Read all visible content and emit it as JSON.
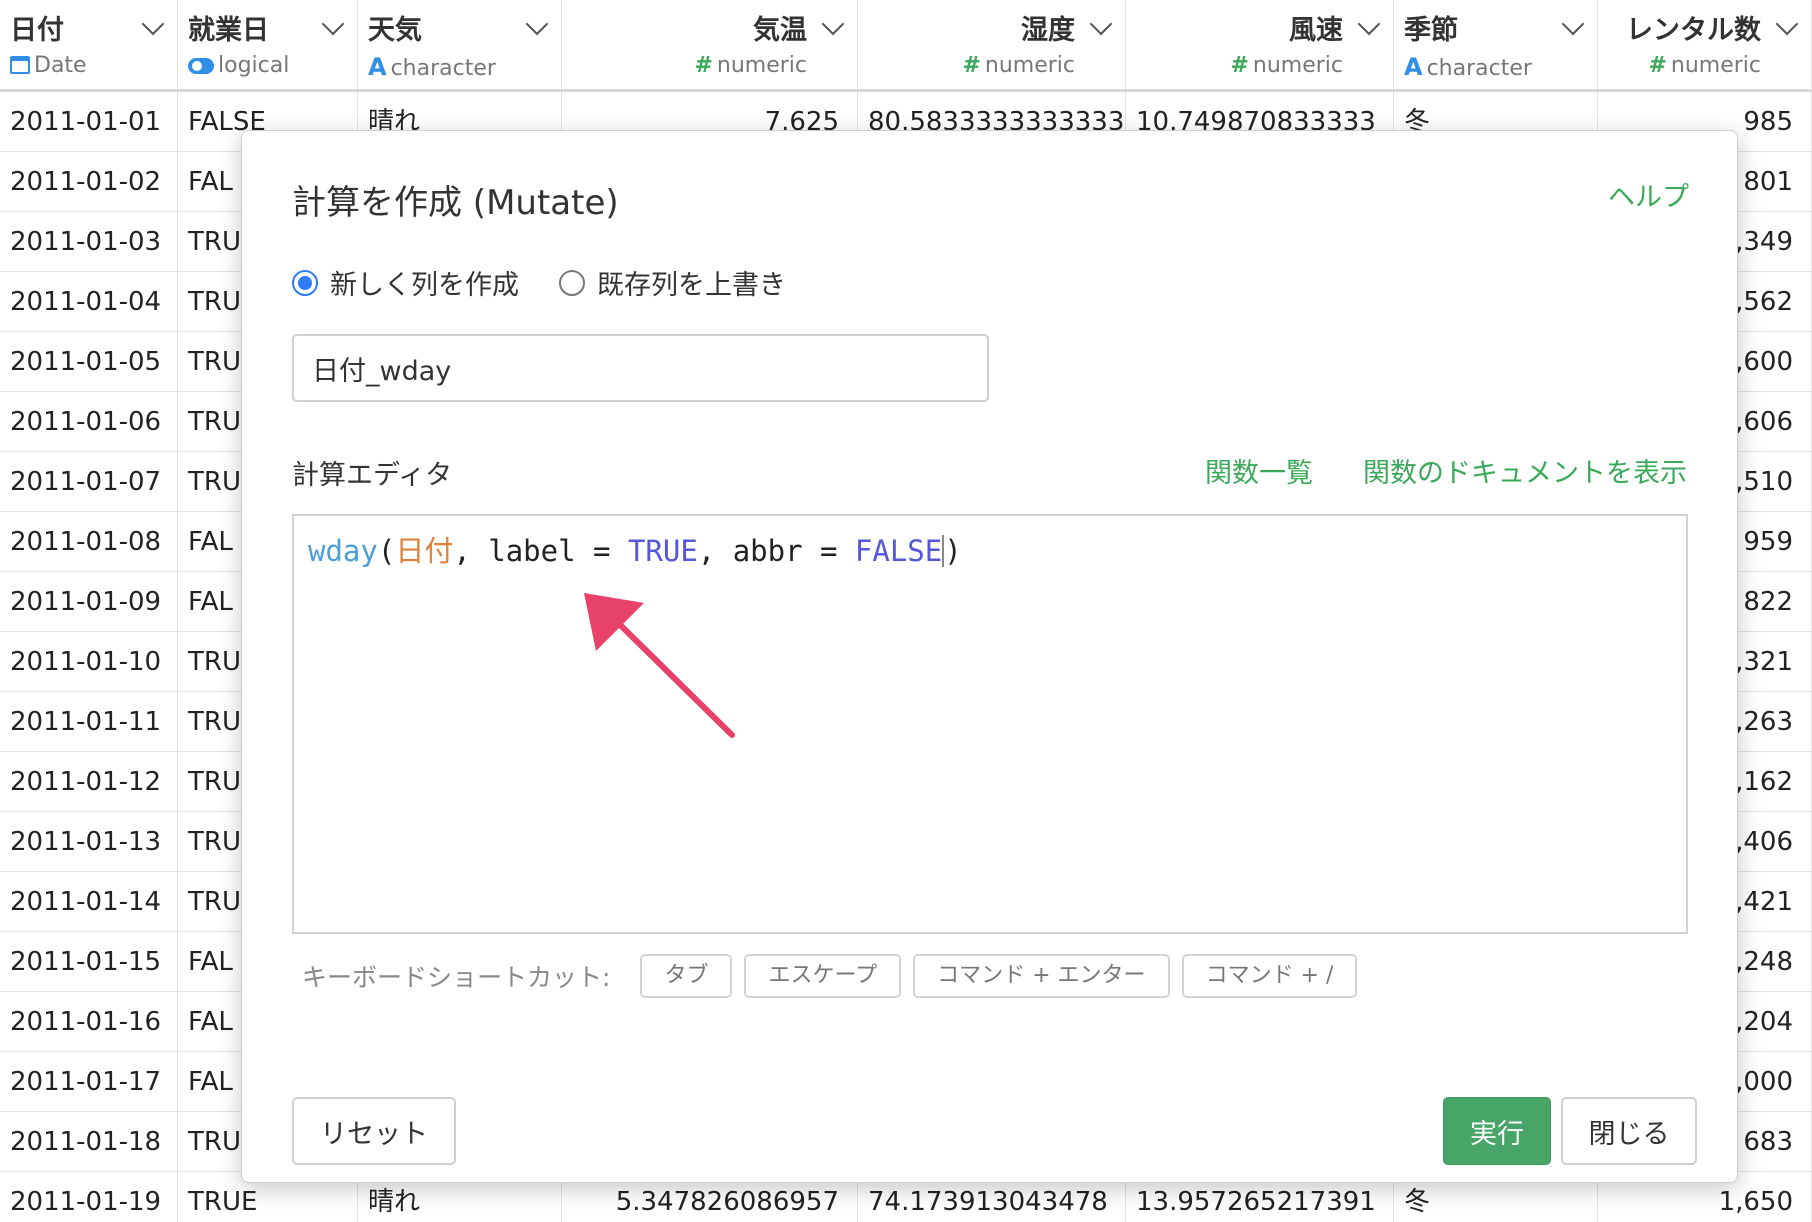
{
  "columns": [
    {
      "name": "日付",
      "type_icon": "calendar-icon",
      "type": "Date",
      "align": "left"
    },
    {
      "name": "就業日",
      "type_icon": "toggle-icon",
      "type": "logical",
      "align": "left"
    },
    {
      "name": "天気",
      "type_icon": "character-icon",
      "type": "character",
      "align": "left"
    },
    {
      "name": "気温",
      "type_icon": "numeric-icon",
      "type": "numeric",
      "align": "right"
    },
    {
      "name": "湿度",
      "type_icon": "numeric-icon",
      "type": "numeric",
      "align": "right"
    },
    {
      "name": "風速",
      "type_icon": "numeric-icon",
      "type": "numeric",
      "align": "right"
    },
    {
      "name": "季節",
      "type_icon": "character-icon",
      "type": "character",
      "align": "left"
    },
    {
      "name": "レンタル数",
      "type_icon": "numeric-icon",
      "type": "numeric",
      "align": "right"
    }
  ],
  "type_glyphs": {
    "character": "A",
    "numeric": "#"
  },
  "rows": [
    [
      "2011-01-01",
      "FALSE",
      "晴れ",
      "7.625",
      "80.5833333333333",
      "10.749870833333",
      "冬",
      "985"
    ],
    [
      "2011-01-02",
      "FAL",
      "",
      "",
      "",
      "",
      "",
      "801"
    ],
    [
      "2011-01-03",
      "TRU",
      "",
      "",
      "",
      "",
      "",
      ",349"
    ],
    [
      "2011-01-04",
      "TRU",
      "",
      "",
      "",
      "",
      "",
      ",562"
    ],
    [
      "2011-01-05",
      "TRU",
      "",
      "",
      "",
      "",
      "",
      ",600"
    ],
    [
      "2011-01-06",
      "TRU",
      "",
      "",
      "",
      "",
      "",
      ",606"
    ],
    [
      "2011-01-07",
      "TRU",
      "",
      "",
      "",
      "",
      "",
      ",510"
    ],
    [
      "2011-01-08",
      "FAL",
      "",
      "",
      "",
      "",
      "",
      "959"
    ],
    [
      "2011-01-09",
      "FAL",
      "",
      "",
      "",
      "",
      "",
      "822"
    ],
    [
      "2011-01-10",
      "TRU",
      "",
      "",
      "",
      "",
      "",
      ",321"
    ],
    [
      "2011-01-11",
      "TRU",
      "",
      "",
      "",
      "",
      "",
      ",263"
    ],
    [
      "2011-01-12",
      "TRU",
      "",
      "",
      "",
      "",
      "",
      ",162"
    ],
    [
      "2011-01-13",
      "TRU",
      "",
      "",
      "",
      "",
      "",
      ",406"
    ],
    [
      "2011-01-14",
      "TRU",
      "",
      "",
      "",
      "",
      "",
      ",421"
    ],
    [
      "2011-01-15",
      "FAL",
      "",
      "",
      "",
      "",
      "",
      ",248"
    ],
    [
      "2011-01-16",
      "FAL",
      "",
      "",
      "",
      "",
      "",
      ",204"
    ],
    [
      "2011-01-17",
      "FAL",
      "",
      "",
      "",
      "",
      "",
      ",000"
    ],
    [
      "2011-01-18",
      "TRU",
      "",
      "",
      "",
      "",
      "",
      "683"
    ],
    [
      "2011-01-19",
      "TRUE",
      "晴れ",
      "5.347826086957",
      "74.173913043478",
      "13.957265217391",
      "冬",
      "1,650"
    ]
  ],
  "modal": {
    "title": "計算を作成 (Mutate)",
    "help_label": "ヘルプ",
    "radio_new": "新しく列を作成",
    "radio_overwrite": "既存列を上書き",
    "selected_mode": "new",
    "column_name_value": "日付_wday",
    "editor_label": "計算エディタ",
    "functions_link": "関数一覧",
    "docs_link": "関数のドキュメントを表示",
    "code_tokens": [
      {
        "text": "wday",
        "kind": "fn"
      },
      {
        "text": "(",
        "kind": "plain"
      },
      {
        "text": "日付",
        "kind": "arg"
      },
      {
        "text": ", label = ",
        "kind": "plain"
      },
      {
        "text": "TRUE",
        "kind": "kw"
      },
      {
        "text": ", abbr = ",
        "kind": "plain"
      },
      {
        "text": "FALSE",
        "kind": "kw"
      },
      {
        "text": ")",
        "kind": "plain"
      }
    ],
    "shortcuts_label": "キーボードショートカット:",
    "shortcuts": [
      "タブ",
      "エスケープ",
      "コマンド + エンター",
      "コマンド + /"
    ],
    "reset_label": "リセット",
    "run_label": "実行",
    "close_label": "閉じる"
  },
  "colors": {
    "accent_green": "#46a567",
    "link_green": "#3aa95a",
    "radio_blue": "#2f7cf6",
    "annotation_arrow": "#e8416a"
  }
}
